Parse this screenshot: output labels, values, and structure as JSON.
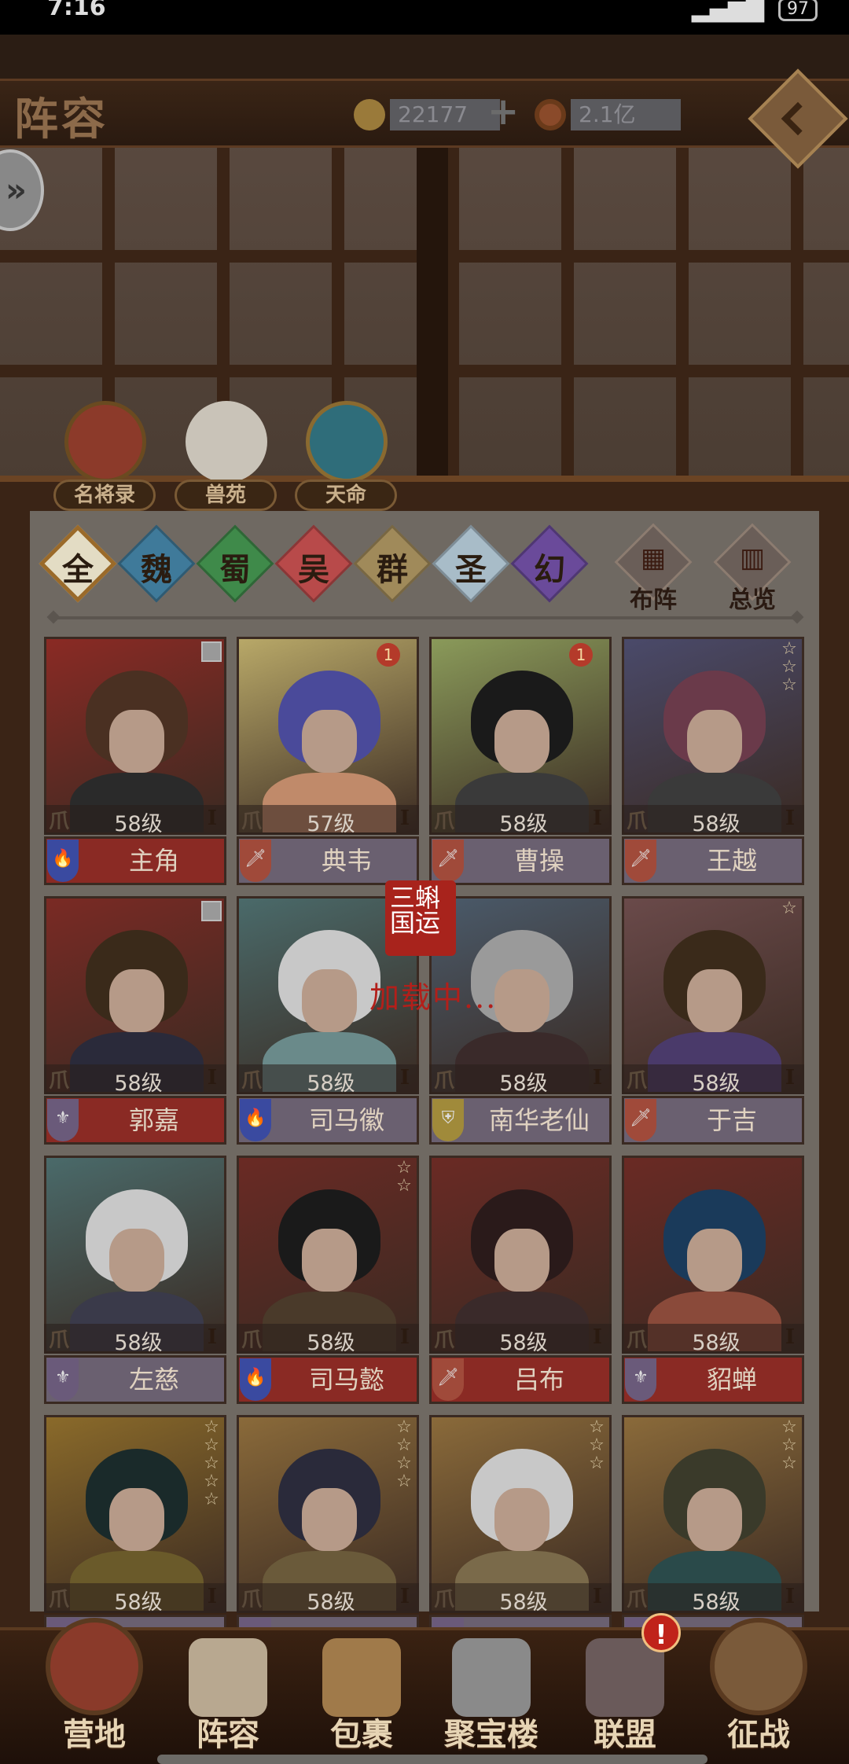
{
  "status": {
    "time": "7:16",
    "battery": "97"
  },
  "header": {
    "title": "阵容",
    "gold": "22177",
    "coins": "2.1亿",
    "plus": "+"
  },
  "side_button": {
    "glyph": "»"
  },
  "categories": [
    {
      "label": "名将录",
      "color": "#8c3a2a"
    },
    {
      "label": "兽苑",
      "color": "#c9c3b8"
    },
    {
      "label": "天命",
      "color": "#2f6d7a"
    }
  ],
  "factions": [
    {
      "label": "全",
      "color": "#e3dcc4"
    },
    {
      "label": "魏",
      "color": "#3f7a9a"
    },
    {
      "label": "蜀",
      "color": "#3f8a4a"
    },
    {
      "label": "吴",
      "color": "#b84a4a"
    },
    {
      "label": "群",
      "color": "#a08a5a"
    },
    {
      "label": "圣",
      "color": "#a8bcc8"
    },
    {
      "label": "幻",
      "color": "#6a4a9a"
    }
  ],
  "tools": [
    {
      "label": "布阵",
      "icon": "grid-icon",
      "glyph": "▦"
    },
    {
      "label": "总览",
      "icon": "list-icon",
      "glyph": "▥"
    }
  ],
  "heroes": [
    {
      "name": "主角",
      "level": "58级",
      "grade": "I",
      "bg": "#8a2a24",
      "hair": "#4a3022",
      "body": "#2a2a2a",
      "role_color": "#3a4aa0",
      "role_glyph": "🔥",
      "name_bg": "#8a2a24",
      "stars": 0,
      "badge": "",
      "slot": true
    },
    {
      "name": "典韦",
      "level": "57级",
      "grade": "I",
      "bg": "#b8a868",
      "hair": "#4a4a9a",
      "body": "#c08a6a",
      "role_color": "#a04a3a",
      "role_glyph": "🗡",
      "name_bg": "#6a6070",
      "stars": 0,
      "badge": "1",
      "slot": false
    },
    {
      "name": "曹操",
      "level": "58级",
      "grade": "I",
      "bg": "#8a9a5a",
      "hair": "#1a1a1a",
      "body": "#3a3a3a",
      "role_color": "#a04a3a",
      "role_glyph": "🗡",
      "name_bg": "#6a6070",
      "stars": 0,
      "badge": "1",
      "slot": false
    },
    {
      "name": "王越",
      "level": "58级",
      "grade": "I",
      "bg": "#4a4a6a",
      "hair": "#6a3a4a",
      "body": "#3a3a3a",
      "role_color": "#a04a3a",
      "role_glyph": "🗡",
      "name_bg": "#6a6070",
      "stars": 3,
      "badge": "",
      "slot": false
    },
    {
      "name": "郭嘉",
      "level": "58级",
      "grade": "I",
      "bg": "#7a2a24",
      "hair": "#3a2a1a",
      "body": "#2a2a3a",
      "role_color": "#6a5a7a",
      "role_glyph": "⚜",
      "name_bg": "#8a2a24",
      "stars": 0,
      "badge": "",
      "slot": true
    },
    {
      "name": "司马徽",
      "level": "58级",
      "grade": "I",
      "bg": "#4a6a6a",
      "hair": "#c8c8c8",
      "body": "#6a8a8a",
      "role_color": "#3a4aa0",
      "role_glyph": "🔥",
      "name_bg": "#6a6070",
      "stars": 0,
      "badge": "",
      "slot": false
    },
    {
      "name": "南华老仙",
      "level": "58级",
      "grade": "I",
      "bg": "#4a5a6a",
      "hair": "#9a9a9a",
      "body": "#3a2a2a",
      "role_color": "#a08a3a",
      "role_glyph": "⛨",
      "name_bg": "#6a6070",
      "stars": 0,
      "badge": "",
      "slot": false
    },
    {
      "name": "于吉",
      "level": "58级",
      "grade": "I",
      "bg": "#6a4a4a",
      "hair": "#3a2a1a",
      "body": "#4a3a6a",
      "role_color": "#a04a3a",
      "role_glyph": "🗡",
      "name_bg": "#6a6070",
      "stars": 1,
      "badge": "",
      "slot": false
    },
    {
      "name": "左慈",
      "level": "58级",
      "grade": "I",
      "bg": "#4a6a6a",
      "hair": "#c8c8c8",
      "body": "#3a3a4a",
      "role_color": "#6a5a7a",
      "role_glyph": "⚜",
      "name_bg": "#6a6070",
      "stars": 0,
      "badge": "",
      "slot": false
    },
    {
      "name": "司马懿",
      "level": "58级",
      "grade": "I",
      "bg": "#6a2a24",
      "hair": "#1a1a1a",
      "body": "#4a3a2a",
      "role_color": "#3a4aa0",
      "role_glyph": "🔥",
      "name_bg": "#8a2a24",
      "stars": 2,
      "badge": "",
      "slot": false
    },
    {
      "name": "吕布",
      "level": "58级",
      "grade": "I",
      "bg": "#6a2a24",
      "hair": "#2a1a1a",
      "body": "#3a2a2a",
      "role_color": "#a04a3a",
      "role_glyph": "🗡",
      "name_bg": "#8a2a24",
      "stars": 0,
      "badge": "",
      "slot": false
    },
    {
      "name": "貂蝉",
      "level": "58级",
      "grade": "I",
      "bg": "#6a2a24",
      "hair": "#1a3a5a",
      "body": "#8a4a3a",
      "role_color": "#6a5a7a",
      "role_glyph": "⚜",
      "name_bg": "#8a2a24",
      "stars": 0,
      "badge": "",
      "slot": false
    },
    {
      "name": "",
      "level": "58级",
      "grade": "I",
      "bg": "#8a6a2a",
      "hair": "#1a2a2a",
      "body": "#6a5a2a",
      "role_color": "#6a5a7a",
      "role_glyph": "",
      "name_bg": "#6a6070",
      "stars": 5,
      "badge": "",
      "slot": false
    },
    {
      "name": "",
      "level": "58级",
      "grade": "I",
      "bg": "#8a6a3a",
      "hair": "#2a2a3a",
      "body": "#6a5a3a",
      "role_color": "#6a5a7a",
      "role_glyph": "",
      "name_bg": "#6a6070",
      "stars": 4,
      "badge": "",
      "slot": false
    },
    {
      "name": "",
      "level": "58级",
      "grade": "I",
      "bg": "#8a6a3a",
      "hair": "#c8c8c8",
      "body": "#7a6a4a",
      "role_color": "#6a5a7a",
      "role_glyph": "",
      "name_bg": "#6a6070",
      "stars": 3,
      "badge": "",
      "slot": false
    },
    {
      "name": "",
      "level": "58级",
      "grade": "I",
      "bg": "#8a6a3a",
      "hair": "#3a3a2a",
      "body": "#2a4a4a",
      "role_color": "#6a5a7a",
      "role_glyph": "",
      "name_bg": "#6a6070",
      "stars": 3,
      "badge": "",
      "slot": false
    }
  ],
  "loading": {
    "seal": "三蝌国运",
    "text": "加载中..."
  },
  "nav": [
    {
      "label": "营地",
      "color": "#8a3a2a",
      "big": true
    },
    {
      "label": "阵容",
      "color": "#b8a890",
      "big": false
    },
    {
      "label": "包裹",
      "color": "#a07a4a",
      "big": false
    },
    {
      "label": "聚宝楼",
      "color": "#8a8a8a",
      "big": false
    },
    {
      "label": "联盟",
      "color": "#6a5a5a",
      "big": false
    },
    {
      "label": "征战",
      "color": "#7a5a3a",
      "big": true
    }
  ],
  "alert": "!"
}
